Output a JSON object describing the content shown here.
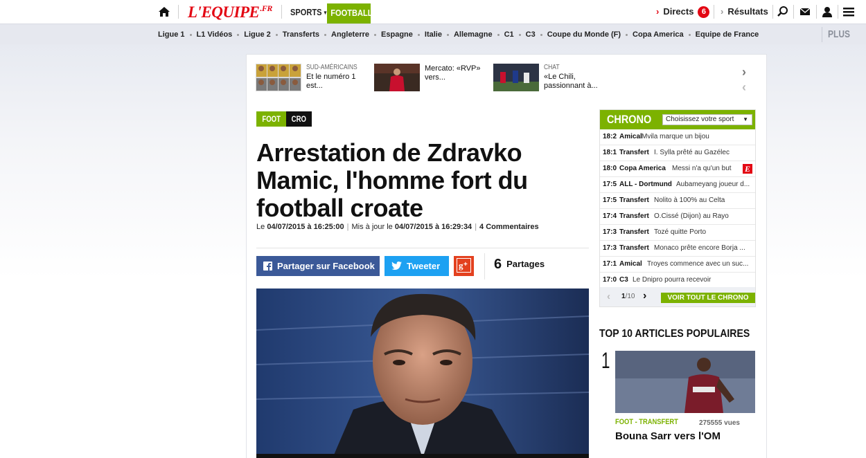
{
  "header": {
    "logo_text": "L'EQUIPE",
    "logo_suffix": ".FR",
    "sports_label": "SPORTS",
    "football_label": "FOOTBALL",
    "directs_label": "Directs",
    "directs_count": "6",
    "resultats_label": "Résultats",
    "icons": [
      "home-icon",
      "search-icon",
      "mail-icon",
      "user-icon",
      "menu-icon"
    ]
  },
  "subnav": {
    "items": [
      "Ligue 1",
      "L1 Vidéos",
      "Ligue 2",
      "Transferts",
      "Angleterre",
      "Espagne",
      "Italie",
      "Allemagne",
      "C1",
      "C3",
      "Coupe du Monde (F)",
      "Copa America",
      "Equipe de France"
    ],
    "plus_label": "PLUS"
  },
  "teasers": [
    {
      "category": "SUD-AMÉRICAINS",
      "text": "Et le numéro 1 est..."
    },
    {
      "category": "",
      "text": "Mercato: «RVP» vers..."
    },
    {
      "category": "CHAT",
      "text": "«Le Chili, passionnant à..."
    }
  ],
  "article": {
    "tag_sport": "FOOT",
    "tag_country": "CRO",
    "headline": "Arrestation de Zdravko Mamic, l'homme fort du football croate",
    "meta_published_prefix": "Le",
    "meta_published": "04/07/2015 à 16:25:00",
    "meta_updated_prefix": "Mis à jour le",
    "meta_updated": "04/07/2015 à 16:29:34",
    "meta_comments": "4 Commentaires",
    "share_facebook": "Partager sur Facebook",
    "share_twitter": "Tweeter",
    "share_count": "6",
    "share_count_label": "Partages"
  },
  "chrono": {
    "title": "CHRONO",
    "select_placeholder": "Choisissez votre sport",
    "rows": [
      {
        "time": "18:2",
        "cat": "Amical",
        "text": "Mvila marque un bijou",
        "flag": ""
      },
      {
        "time": "18:1",
        "cat": "Transfert",
        "text": "I. Sylla prêté au Gazélec",
        "flag": ""
      },
      {
        "time": "18:0",
        "cat": "Copa America",
        "text": "Messi n'a qu'un but",
        "flag": "E"
      },
      {
        "time": "17:5",
        "cat": "ALL - Dortmund",
        "text": "Aubameyang joueur d...",
        "flag": ""
      },
      {
        "time": "17:5",
        "cat": "Transfert",
        "text": "Nolito à 100% au Celta",
        "flag": ""
      },
      {
        "time": "17:4",
        "cat": "Transfert",
        "text": "O.Cissé (Dijon) au Rayo",
        "flag": ""
      },
      {
        "time": "17:3",
        "cat": "Transfert",
        "text": "Tozé quitte Porto",
        "flag": ""
      },
      {
        "time": "17:3",
        "cat": "Transfert",
        "text": "Monaco prête encore Borja ...",
        "flag": ""
      },
      {
        "time": "17:1",
        "cat": "Amical",
        "text": "Troyes commence avec un suc...",
        "flag": ""
      },
      {
        "time": "17:0",
        "cat": "C3",
        "text": "Le Dnipro pourra recevoir",
        "flag": ""
      }
    ],
    "page_current": "1",
    "page_total": "/10",
    "see_all": "VOIR TOUT LE CHRONO"
  },
  "popular": {
    "title": "TOP 10 ARTICLES POPULAIRES",
    "items": [
      {
        "rank": "1",
        "category": "FOOT - TRANSFERT",
        "views": "275555 vues",
        "title": "Bouna Sarr vers l'OM"
      }
    ]
  },
  "colors": {
    "brand_red": "#e30613",
    "football_green": "#7cb200",
    "facebook": "#3b5998",
    "twitter": "#1da1f2",
    "googleplus": "#e3411f"
  }
}
